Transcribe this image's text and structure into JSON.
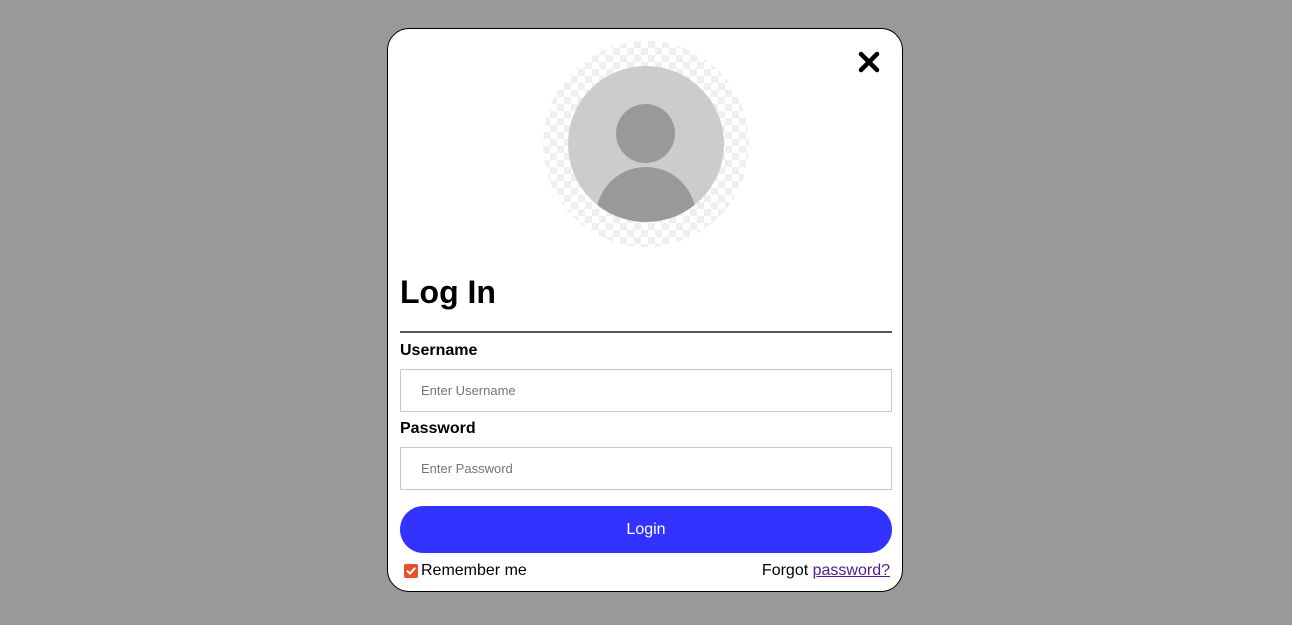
{
  "dialog": {
    "title": "Log In",
    "close_icon": "close-icon",
    "avatar_icon": "user-avatar-icon"
  },
  "form": {
    "username": {
      "label": "Username",
      "placeholder": "Enter Username",
      "value": ""
    },
    "password": {
      "label": "Password",
      "placeholder": "Enter Password",
      "value": ""
    },
    "login_label": "Login",
    "remember": {
      "label": "Remember me",
      "checked": true
    },
    "forgot": {
      "prefix": "Forgot",
      "link": "password?"
    }
  },
  "colors": {
    "backdrop": "#999999",
    "login_button": "#3333ff",
    "checkbox": "#e8502a",
    "link": "#551a8b"
  }
}
